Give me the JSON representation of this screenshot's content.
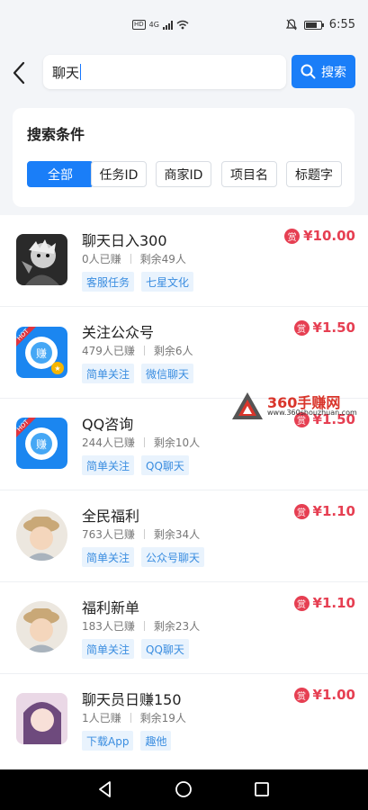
{
  "status_bar": {
    "hd_label": "HD",
    "network": "4G",
    "time": "6:55"
  },
  "header": {
    "back_icon": "chevron-left-icon",
    "search_value": "聊天",
    "search_button_label": "搜索"
  },
  "filter": {
    "title": "搜索条件",
    "chips": [
      "全部",
      "任务ID",
      "商家ID",
      "项目名",
      "标题字"
    ],
    "active_index": 0
  },
  "tasks": [
    {
      "title": "聊天日入300",
      "earned": "0人已赚",
      "remaining": "剩余49人",
      "tags": [
        "客服任务",
        "七星文化"
      ],
      "reward_badge": "赏",
      "reward": "¥10.00",
      "thumb": "anime-dark"
    },
    {
      "title": "关注公众号",
      "earned": "479人已赚",
      "remaining": "剩余6人",
      "tags": [
        "简单关注",
        "微信聊天"
      ],
      "reward_badge": "赏",
      "reward": "¥1.50",
      "thumb": "blue-hot",
      "hot_label": "HOT",
      "thumb_char": "赚"
    },
    {
      "title": "QQ咨询",
      "earned": "244人已赚",
      "remaining": "剩余10人",
      "tags": [
        "简单关注",
        "QQ聊天"
      ],
      "reward_badge": "赏",
      "reward": "¥1.50",
      "thumb": "blue-hot",
      "hot_label": "HOT",
      "thumb_char": "赚"
    },
    {
      "title": "全民福利",
      "earned": "763人已赚",
      "remaining": "剩余34人",
      "tags": [
        "简单关注",
        "公众号聊天"
      ],
      "reward_badge": "赏",
      "reward": "¥1.10",
      "thumb": "baby"
    },
    {
      "title": "福利新单",
      "earned": "183人已赚",
      "remaining": "剩余23人",
      "tags": [
        "简单关注",
        "QQ聊天"
      ],
      "reward_badge": "赏",
      "reward": "¥1.10",
      "thumb": "baby"
    },
    {
      "title": "聊天员日赚150",
      "earned": "1人已赚",
      "remaining": "剩余19人",
      "tags": [
        "下载App",
        "趣他"
      ],
      "reward_badge": "赏",
      "reward": "¥1.00",
      "thumb": "anime-girl"
    }
  ],
  "watermark": {
    "title": "360手赚网",
    "url": "www.360shouzhuan.com"
  },
  "nav_bar": [
    "back-triangle-icon",
    "home-circle-icon",
    "recents-square-icon"
  ],
  "colors": {
    "primary": "#1a7ef8",
    "reward": "#e63f52",
    "tag_bg": "#e9f3fd",
    "tag_text": "#3a8de0"
  }
}
